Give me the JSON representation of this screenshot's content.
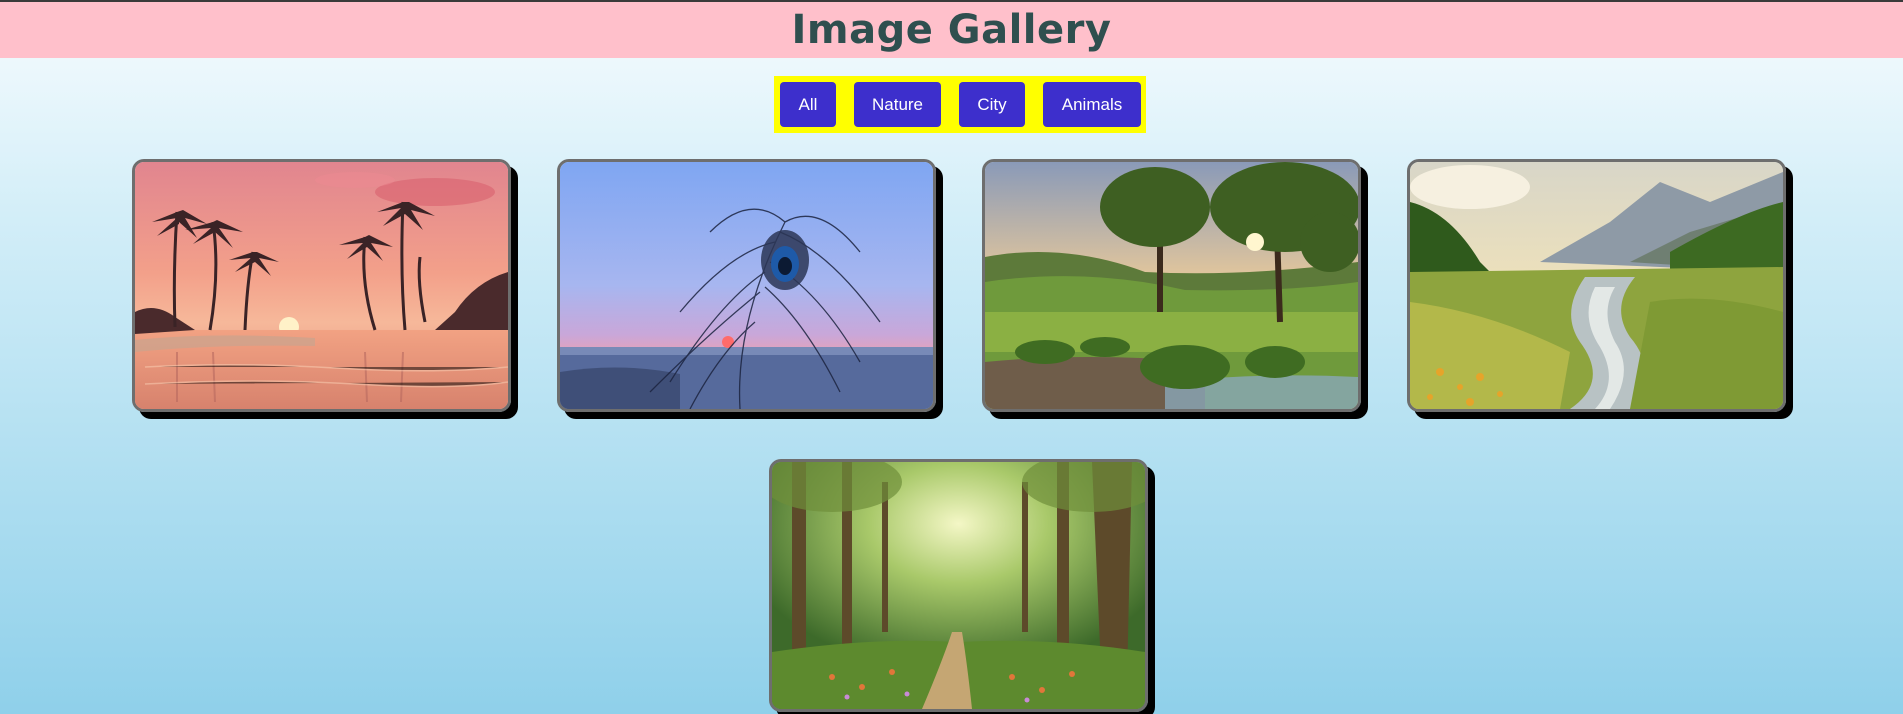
{
  "header": {
    "title": "Image Gallery"
  },
  "filters": [
    {
      "label": "All"
    },
    {
      "label": "Nature"
    },
    {
      "label": "City"
    },
    {
      "label": "Animals"
    }
  ],
  "gallery": {
    "images": [
      {
        "name": "palm-beach-sunset-image"
      },
      {
        "name": "peacock-feather-image"
      },
      {
        "name": "meadow-trees-sunlight-image"
      },
      {
        "name": "mountain-river-valley-image"
      },
      {
        "name": "forest-path-image"
      }
    ]
  },
  "colors": {
    "header_bg": "#ffc0cb",
    "title_text": "#2f4f4f",
    "filter_bar_bg": "#ffff00",
    "button_bg": "#3d2fcc",
    "button_text": "#ffffff"
  }
}
